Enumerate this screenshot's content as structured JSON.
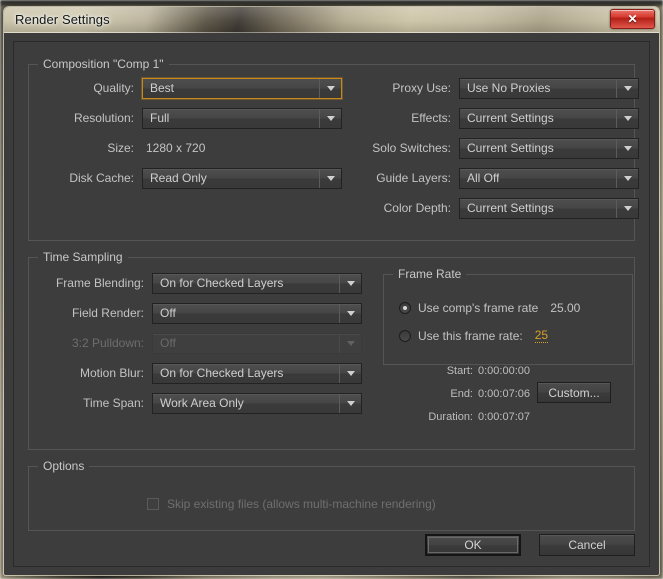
{
  "window": {
    "title": "Render Settings",
    "close_icon": "close-icon",
    "close_glyph": "✕"
  },
  "composition": {
    "legend": "Composition \"Comp 1\"",
    "left_fields": [
      {
        "label": "Quality:",
        "value": "Best",
        "focused": true,
        "disabled": false
      },
      {
        "label": "Resolution:",
        "value": "Full",
        "focused": false,
        "disabled": false
      },
      {
        "label": "Disk Cache:",
        "value": "Read Only",
        "focused": false,
        "disabled": false
      }
    ],
    "size_label": "Size:",
    "size_value": "1280 x 720",
    "right_fields": [
      {
        "label": "Proxy Use:",
        "value": "Use No Proxies",
        "focused": false,
        "disabled": false
      },
      {
        "label": "Effects:",
        "value": "Current Settings",
        "focused": false,
        "disabled": false
      },
      {
        "label": "Solo Switches:",
        "value": "Current Settings",
        "focused": false,
        "disabled": false
      },
      {
        "label": "Guide Layers:",
        "value": "All Off",
        "focused": false,
        "disabled": false
      },
      {
        "label": "Color Depth:",
        "value": "Current Settings",
        "focused": false,
        "disabled": false
      }
    ]
  },
  "time_sampling": {
    "legend": "Time Sampling",
    "fields": [
      {
        "label": "Frame Blending:",
        "value": "On for Checked Layers",
        "disabled": false
      },
      {
        "label": "Field Render:",
        "value": "Off",
        "disabled": false
      },
      {
        "label": "3:2 Pulldown:",
        "value": "Off",
        "disabled": true
      },
      {
        "label": "Motion Blur:",
        "value": "On for Checked Layers",
        "disabled": false
      },
      {
        "label": "Time Span:",
        "value": "Work Area Only",
        "disabled": false
      }
    ]
  },
  "frame_rate": {
    "legend": "Frame Rate",
    "use_comp_label": "Use comp's frame rate",
    "use_comp_value": "25.00",
    "use_comp_selected": true,
    "use_this_label": "Use this frame rate:",
    "use_this_value": "25",
    "use_this_selected": false
  },
  "time_info": {
    "start_label": "Start:",
    "start_value": "0:00:00:00",
    "end_label": "End:",
    "end_value": "0:00:07:06",
    "duration_label": "Duration:",
    "duration_value": "0:00:07:07",
    "custom_button": "Custom..."
  },
  "options": {
    "legend": "Options",
    "skip_label": "Skip existing files (allows multi-machine rendering)",
    "skip_checked": false,
    "skip_disabled": true
  },
  "footer": {
    "ok_label": "OK",
    "cancel_label": "Cancel"
  },
  "colors": {
    "accent_orange": "#c8891c",
    "hot_text": "#d99e2b",
    "dialog_bg": "#3d3d3d",
    "close_red": "#d4342a"
  }
}
